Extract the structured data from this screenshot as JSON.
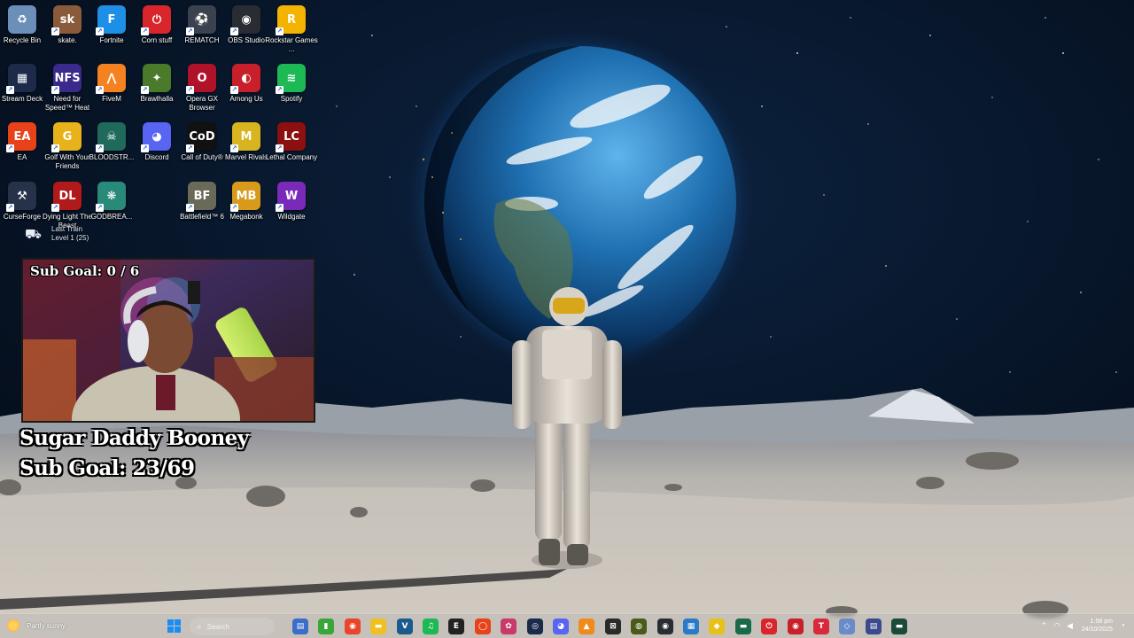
{
  "desktop": {
    "icons": [
      {
        "label": "Recycle Bin",
        "glyph": "♻",
        "color": "#6b8fb8",
        "icon": "recycle-bin-icon"
      },
      {
        "label": "skate.",
        "glyph": "sk",
        "color": "#8a5a3a",
        "icon": "skate-icon"
      },
      {
        "label": "Fortnite",
        "glyph": "F",
        "color": "#1e8fe6",
        "icon": "fortnite-icon"
      },
      {
        "label": "Corn stuff",
        "glyph": "⏻",
        "color": "#d8262c",
        "icon": "power-icon"
      },
      {
        "label": "REMATCH",
        "glyph": "⚽",
        "color": "#3a4250",
        "icon": "rematch-icon"
      },
      {
        "label": "OBS Studio",
        "glyph": "◉",
        "color": "#2a2c33",
        "icon": "obs-icon"
      },
      {
        "label": "Rockstar Games ...",
        "glyph": "R",
        "color": "#f2b400",
        "icon": "rockstar-icon"
      },
      {
        "label": "Stream Deck",
        "glyph": "▦",
        "color": "#1d2a4a",
        "icon": "stream-deck-icon"
      },
      {
        "label": "Need for Speed™ Heat",
        "glyph": "NFS",
        "color": "#3a2a8c",
        "icon": "nfs-icon"
      },
      {
        "label": "FiveM",
        "glyph": "⋀",
        "color": "#f58220",
        "icon": "fivem-icon"
      },
      {
        "label": "Brawlhalla",
        "glyph": "✦",
        "color": "#4a7a2a",
        "icon": "brawlhalla-icon"
      },
      {
        "label": "Opera GX Browser",
        "glyph": "O",
        "color": "#b0122a",
        "icon": "opera-gx-icon"
      },
      {
        "label": "Among Us",
        "glyph": "◐",
        "color": "#c8202a",
        "icon": "among-us-icon"
      },
      {
        "label": "Spotify",
        "glyph": "≋",
        "color": "#1db954",
        "icon": "spotify-icon"
      },
      {
        "label": "EA",
        "glyph": "EA",
        "color": "#e8421a",
        "icon": "ea-icon"
      },
      {
        "label": "Golf With Your Friends",
        "glyph": "G",
        "color": "#e8b21a",
        "icon": "golf-icon"
      },
      {
        "label": "BLOODSTR...",
        "glyph": "☠",
        "color": "#1f6a5a",
        "icon": "bloodstrike-icon"
      },
      {
        "label": "Discord",
        "glyph": "◕",
        "color": "#5865f2",
        "icon": "discord-icon"
      },
      {
        "label": "Call of Duty®",
        "glyph": "CoD",
        "color": "#111111",
        "icon": "call-of-duty-icon"
      },
      {
        "label": "Marvel Rivals",
        "glyph": "M",
        "color": "#d8b420",
        "icon": "marvel-rivals-icon"
      },
      {
        "label": "Lethal Company",
        "glyph": "LC",
        "color": "#8c1010",
        "icon": "lethal-company-icon"
      },
      {
        "label": "CurseForge",
        "glyph": "⚒",
        "color": "#26324a",
        "icon": "curseforge-icon"
      },
      {
        "label": "Dying Light The Beast",
        "glyph": "DL",
        "color": "#b01a1a",
        "icon": "dying-light-icon"
      },
      {
        "label": "GODBREA...",
        "glyph": "❋",
        "color": "#2a8a7a",
        "icon": "godbreakers-icon"
      },
      {
        "label": "Battlefield™ 6",
        "glyph": "BF",
        "color": "#6a6a58",
        "icon": "battlefield-icon"
      },
      {
        "label": "Megabonk",
        "glyph": "MB",
        "color": "#d89a1a",
        "icon": "megabonk-icon"
      },
      {
        "label": "Wildgate",
        "glyph": "W",
        "color": "#7a2ab8",
        "icon": "wildgate-icon"
      }
    ],
    "ghost_item": {
      "title": "Last Train",
      "subtitle": "Level 1  (25)"
    }
  },
  "stream_overlay": {
    "webcam_goal": "Sub Goal: 0 / 6",
    "name_line": "Sugar Daddy Booney",
    "goal_line": "Sub Goal: 23/69"
  },
  "taskbar": {
    "weather_text": "Partly sunny",
    "search_placeholder": "Search",
    "apps": [
      {
        "glyph": "▤",
        "color": "#3a6ec8",
        "icon": "task-view-icon"
      },
      {
        "glyph": "▮",
        "color": "#3aa63a",
        "icon": "xbox-icon"
      },
      {
        "glyph": "◉",
        "color": "#e8452a",
        "icon": "chrome-icon"
      },
      {
        "glyph": "▬",
        "color": "#f0c020",
        "icon": "file-explorer-icon"
      },
      {
        "glyph": "V",
        "color": "#1a5a8c",
        "icon": "vegas-icon"
      },
      {
        "glyph": "♫",
        "color": "#1db954",
        "icon": "spotify-taskbar-icon"
      },
      {
        "glyph": "E",
        "color": "#222222",
        "icon": "epic-games-icon"
      },
      {
        "glyph": "◯",
        "color": "#e8421a",
        "icon": "ea-app-icon"
      },
      {
        "glyph": "✿",
        "color": "#c83a6a",
        "icon": "app-icon"
      },
      {
        "glyph": "◎",
        "color": "#1a2a4a",
        "icon": "steam-icon"
      },
      {
        "glyph": "◕",
        "color": "#5865f2",
        "icon": "discord-taskbar-icon"
      },
      {
        "glyph": "▲",
        "color": "#f08a1a",
        "icon": "vlc-icon"
      },
      {
        "glyph": "⊠",
        "color": "#2a2a2a",
        "icon": "capcut-icon"
      },
      {
        "glyph": "◍",
        "color": "#4a5a1a",
        "icon": "app2-icon"
      },
      {
        "glyph": "◉",
        "color": "#2a2c33",
        "icon": "obs-taskbar-icon"
      },
      {
        "glyph": "▦",
        "color": "#2a7ac8",
        "icon": "app3-icon"
      },
      {
        "glyph": "◆",
        "color": "#e8c01a",
        "icon": "app4-icon"
      },
      {
        "glyph": "▬",
        "color": "#1a6a4a",
        "icon": "app5-icon"
      },
      {
        "glyph": "⏻",
        "color": "#d8262c",
        "icon": "power-taskbar-icon"
      },
      {
        "glyph": "◉",
        "color": "#c8202a",
        "icon": "opera-taskbar-icon"
      },
      {
        "glyph": "T",
        "color": "#d82a3a",
        "icon": "app6-icon"
      },
      {
        "glyph": "◇",
        "color": "#6a8ac8",
        "icon": "app7-icon"
      },
      {
        "glyph": "▤",
        "color": "#3a4a8c",
        "icon": "app8-icon"
      },
      {
        "glyph": "▬",
        "color": "#1a4a3a",
        "icon": "app9-icon"
      }
    ],
    "time": "1:58 pm",
    "date": "24/10/2025"
  }
}
